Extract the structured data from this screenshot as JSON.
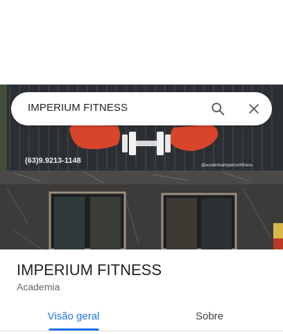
{
  "search": {
    "query": "IMPERIUM FITNESS"
  },
  "photo": {
    "phone_text": "(63)9.9213-1148",
    "instagram_text": "@academiaimperiumfitness"
  },
  "place": {
    "name": "IMPERIUM FITNESS",
    "category": "Academia"
  },
  "tabs": [
    {
      "label": "Visão geral",
      "selected": true
    },
    {
      "label": "Sobre",
      "selected": false
    }
  ],
  "colors": {
    "accent": "#1a73e8",
    "title": "#202124",
    "secondary_text": "#5f6368",
    "sign_red": "#d9452b"
  },
  "icons": {
    "search": "search-icon",
    "close": "close-icon"
  }
}
